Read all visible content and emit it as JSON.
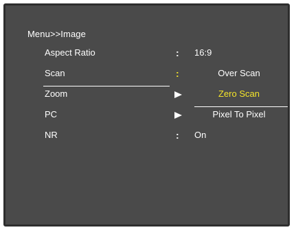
{
  "menu": {
    "title": "Menu>>Image",
    "items": [
      {
        "label": "Aspect Ratio",
        "separator": ":",
        "value": "16:9"
      },
      {
        "label": "Scan",
        "separator": ":",
        "value": "Over Scan"
      },
      {
        "label": "Zoom",
        "option": "Zero Scan"
      },
      {
        "label": "PC",
        "option": "Pixel To Pixel"
      },
      {
        "label": "NR",
        "separator": ":",
        "value": "On"
      }
    ]
  },
  "colors": {
    "background": "#4a4a4a",
    "text": "#ffffff",
    "highlight": "#f5e52a"
  }
}
